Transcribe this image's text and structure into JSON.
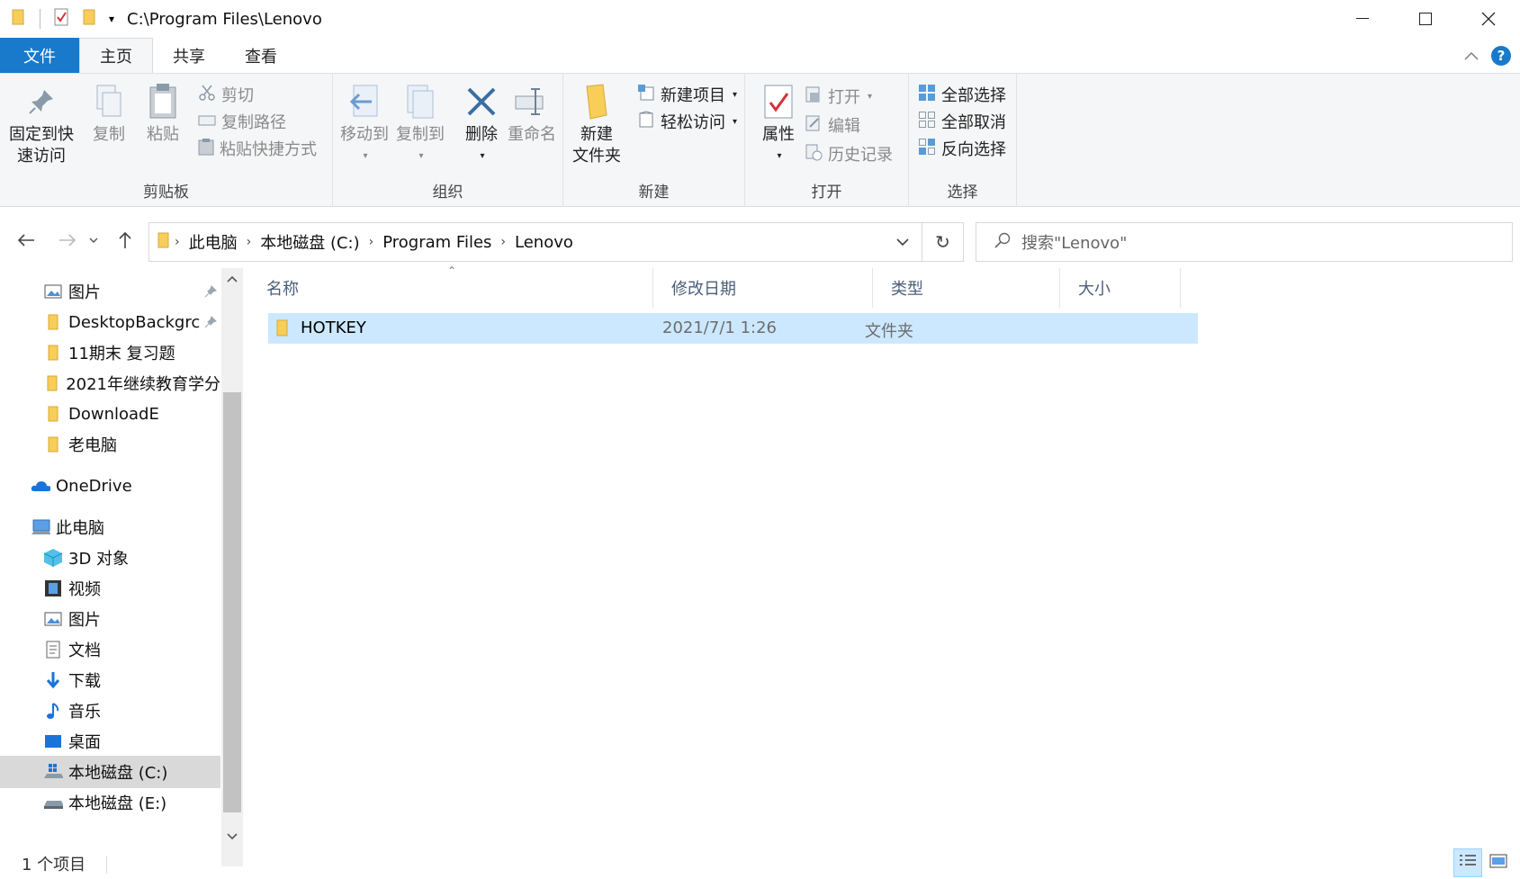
{
  "window": {
    "title": "C:\\Program Files\\Lenovo",
    "minimize_glyph": "—",
    "maximize_glyph": "☐",
    "close_glyph": "✕"
  },
  "tabs": [
    {
      "label": "文件"
    },
    {
      "label": "主页"
    },
    {
      "label": "共享"
    },
    {
      "label": "查看"
    }
  ],
  "ribbon": {
    "clipboard": {
      "label": "剪贴板",
      "pin_quick": "固定到快\n速访问",
      "pin_quick_l1": "固定到快",
      "pin_quick_l2": "速访问",
      "copy": "复制",
      "paste": "粘贴",
      "cut": "剪切",
      "copy_path": "复制路径",
      "paste_shortcut": "粘贴快捷方式"
    },
    "organize": {
      "label": "组织",
      "move_to": "移动到",
      "copy_to": "复制到",
      "delete": "删除",
      "rename": "重命名"
    },
    "new": {
      "label": "新建",
      "new_folder_l1": "新建",
      "new_folder_l2": "文件夹",
      "new_item": "新建项目",
      "easy_access": "轻松访问"
    },
    "open": {
      "label": "打开",
      "properties": "属性",
      "open": "打开",
      "edit": "编辑",
      "history": "历史记录"
    },
    "select": {
      "label": "选择",
      "select_all": "全部选择",
      "select_none": "全部取消",
      "invert": "反向选择"
    }
  },
  "address": {
    "crumbs": [
      "此电脑",
      "本地磁盘 (C:)",
      "Program Files",
      "Lenovo"
    ],
    "search_placeholder": "搜索\"Lenovo\""
  },
  "nav": {
    "items": [
      {
        "label": "图片",
        "icon": "pictures-icon",
        "pinned": true
      },
      {
        "label": "DesktopBackgrc",
        "icon": "folder-icon",
        "pinned": true
      },
      {
        "label": "11期末 复习题",
        "icon": "folder-icon"
      },
      {
        "label": "2021年继续教育学分",
        "icon": "folder-icon"
      },
      {
        "label": "DownloadE",
        "icon": "folder-icon"
      },
      {
        "label": "老电脑",
        "icon": "folder-icon"
      },
      {
        "label": "OneDrive",
        "icon": "onedrive-icon"
      },
      {
        "label": "此电脑",
        "icon": "this-pc-icon"
      },
      {
        "label": "3D 对象",
        "icon": "3d-objects-icon"
      },
      {
        "label": "视频",
        "icon": "videos-icon"
      },
      {
        "label": "图片",
        "icon": "pictures-icon"
      },
      {
        "label": "文档",
        "icon": "documents-icon"
      },
      {
        "label": "下载",
        "icon": "downloads-icon"
      },
      {
        "label": "音乐",
        "icon": "music-icon"
      },
      {
        "label": "桌面",
        "icon": "desktop-icon"
      },
      {
        "label": "本地磁盘 (C:)",
        "icon": "drive-c-icon",
        "selected": true
      },
      {
        "label": "本地磁盘 (E:)",
        "icon": "drive-icon"
      }
    ]
  },
  "list": {
    "columns": [
      "名称",
      "修改日期",
      "类型",
      "大小"
    ],
    "rows": [
      {
        "name": "HOTKEY",
        "modified": "2021/7/1 1:26",
        "type": "文件夹",
        "size": ""
      }
    ]
  },
  "status": {
    "count": "1 个项目"
  },
  "colors": {
    "file_tab": "#1979ca",
    "selection": "#cce8ff",
    "folder": "#f8cd58"
  }
}
